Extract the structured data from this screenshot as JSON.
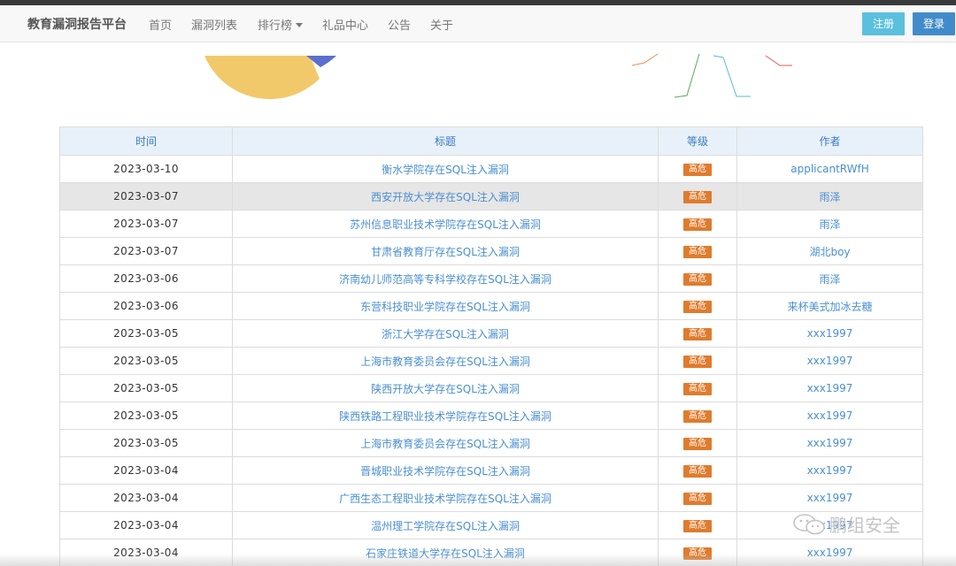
{
  "navbar": {
    "brand": "教育漏洞报告平台",
    "items": [
      {
        "label": "首页"
      },
      {
        "label": "漏洞列表"
      },
      {
        "label": "排行榜"
      },
      {
        "label": "礼品中心"
      },
      {
        "label": "公告"
      },
      {
        "label": "关于"
      }
    ],
    "register_label": "注册",
    "login_label": "登录"
  },
  "colors": {
    "accent": "#428bca",
    "register": "#5bc0de",
    "badge": "#e07b2d",
    "link": "#4a8fd0",
    "pie_yellow": "#f2c96a",
    "pie_blue": "#5b6fcf"
  },
  "table": {
    "headers": {
      "time": "时间",
      "title": "标题",
      "level": "等级",
      "author": "作者"
    },
    "rows": [
      {
        "time": "2023-03-10",
        "title": "衡水学院存在SQL注入漏洞",
        "level": "高危",
        "author": "applicantRWfH"
      },
      {
        "time": "2023-03-07",
        "title": "西安开放大学存在SQL注入漏洞",
        "level": "高危",
        "author": "雨泽"
      },
      {
        "time": "2023-03-07",
        "title": "苏州信息职业技术学院存在SQL注入漏洞",
        "level": "高危",
        "author": "雨泽"
      },
      {
        "time": "2023-03-07",
        "title": "甘肃省教育厅存在SQL注入漏洞",
        "level": "高危",
        "author": "湖北boy"
      },
      {
        "time": "2023-03-06",
        "title": "济南幼儿师范高等专科学校存在SQL注入漏洞",
        "level": "高危",
        "author": "雨泽"
      },
      {
        "time": "2023-03-06",
        "title": "东营科技职业学院存在SQL注入漏洞",
        "level": "高危",
        "author": "来杯美式加冰去糖"
      },
      {
        "time": "2023-03-05",
        "title": "浙江大学存在SQL注入漏洞",
        "level": "高危",
        "author": "xxx1997"
      },
      {
        "time": "2023-03-05",
        "title": "上海市教育委员会存在SQL注入漏洞",
        "level": "高危",
        "author": "xxx1997"
      },
      {
        "time": "2023-03-05",
        "title": "陕西开放大学存在SQL注入漏洞",
        "level": "高危",
        "author": "xxx1997"
      },
      {
        "time": "2023-03-05",
        "title": "陕西铁路工程职业技术学院存在SQL注入漏洞",
        "level": "高危",
        "author": "xxx1997"
      },
      {
        "time": "2023-03-05",
        "title": "上海市教育委员会存在SQL注入漏洞",
        "level": "高危",
        "author": "xxx1997"
      },
      {
        "time": "2023-03-04",
        "title": "晋城职业技术学院存在SQL注入漏洞",
        "level": "高危",
        "author": "xxx1997"
      },
      {
        "time": "2023-03-04",
        "title": "广西生态工程职业技术学院存在SQL注入漏洞",
        "level": "高危",
        "author": "xxx1997"
      },
      {
        "time": "2023-03-04",
        "title": "温州理工学院存在SQL注入漏洞",
        "level": "高危",
        "author": "xxx1997"
      },
      {
        "time": "2023-03-04",
        "title": "石家庄铁道大学存在SQL注入漏洞",
        "level": "高危",
        "author": "xxx1997"
      }
    ]
  },
  "watermark": {
    "icon": "wechat-icon",
    "text": "鹏组安全"
  }
}
